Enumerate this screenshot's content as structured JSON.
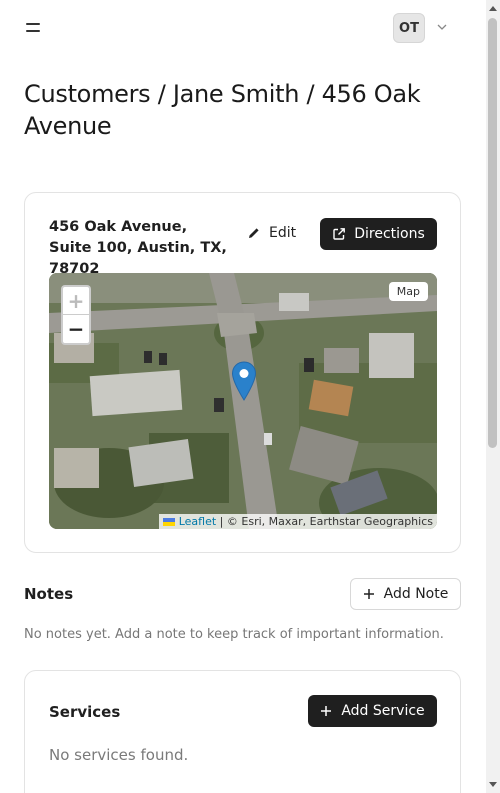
{
  "header": {
    "menu_icon": "hamburger-menu-icon",
    "avatar_initials": "OT",
    "account_menu_icon": "chevron-down-icon"
  },
  "page": {
    "title": "Customers / Jane Smith / 456 Oak Avenue"
  },
  "address_card": {
    "address": "456 Oak Avenue, Suite 100, Austin, TX, 78702",
    "edit_label": "Edit",
    "edit_icon": "pencil-icon",
    "directions_label": "Directions",
    "directions_icon": "external-link-icon",
    "map": {
      "zoom_in": "+",
      "zoom_out": "−",
      "map_type_label": "Map",
      "attribution_link": "Leaflet",
      "attribution_text": " | © Esri, Maxar, Earthstar Geographics",
      "marker_icon": "map-marker-icon",
      "marker_color": "#2a81cb"
    }
  },
  "notes": {
    "label": "Notes",
    "add_label": "Add Note",
    "add_icon": "plus-icon",
    "empty_text": "No notes yet. Add a note to keep track of important information."
  },
  "services": {
    "title": "Services",
    "add_label": "Add Service",
    "add_icon": "plus-icon",
    "empty_text": "No services found."
  },
  "colors": {
    "primary_button": "#1f1f1f",
    "border": "#e3e3e3",
    "muted_text": "#777777"
  }
}
